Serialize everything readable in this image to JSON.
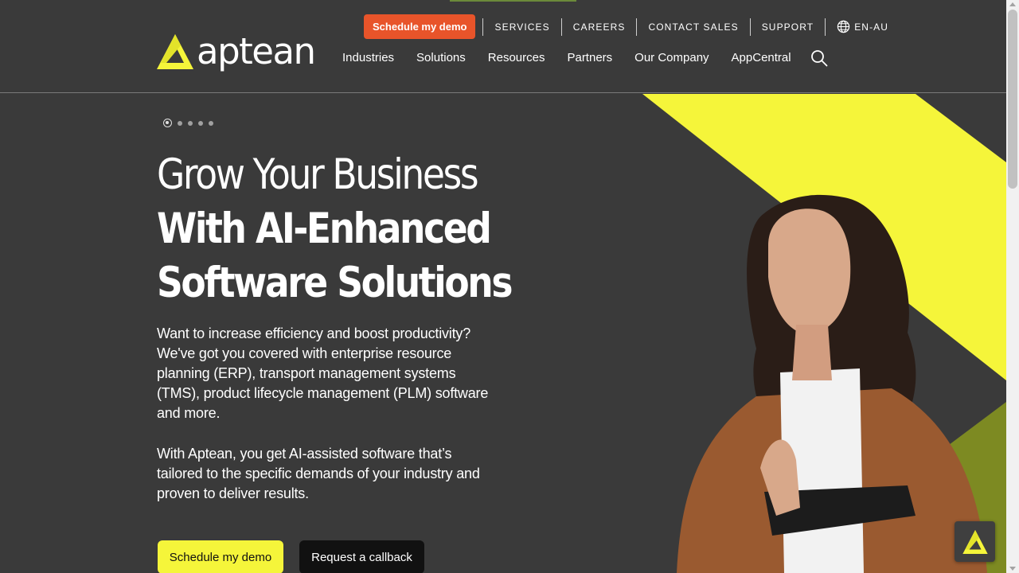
{
  "brand": {
    "name": "aptean",
    "accent": "#f5f53a",
    "demo_orange": "#e8542a"
  },
  "utility": {
    "demo_button": "Schedule my demo",
    "links": [
      "SERVICES",
      "CAREERS",
      "CONTACT SALES",
      "SUPPORT"
    ],
    "locale": "EN-AU"
  },
  "nav": {
    "items": [
      "Industries",
      "Solutions",
      "Resources",
      "Partners",
      "Our Company",
      "AppCentral"
    ]
  },
  "hero": {
    "slides_total": 5,
    "active_slide": 1,
    "headline_line1": "Grow Your Business",
    "headline_line2": "With AI-Enhanced",
    "headline_line3": "Software Solutions",
    "paragraph1": "Want to increase efficiency and boost productivity? We've got you covered with enterprise resource planning (ERP), transport management systems (TMS), product lifecycle management (PLM) software and more.",
    "paragraph2": "With Aptean, you get AI-assisted software that’s tailored to the specific demands of your industry and proven to deliver results.",
    "cta_primary": "Schedule my demo",
    "cta_secondary": "Request a callback"
  }
}
